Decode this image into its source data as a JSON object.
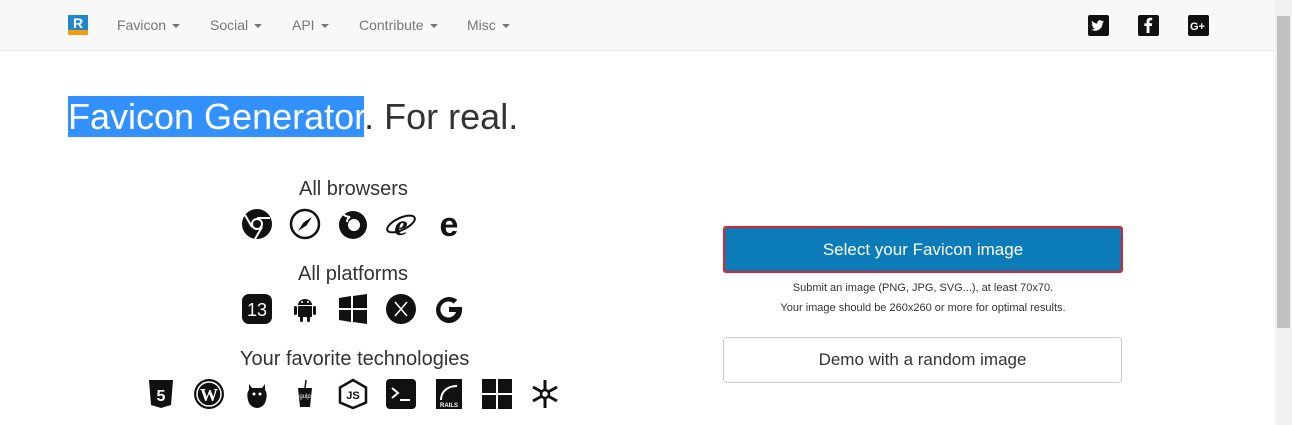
{
  "nav": {
    "items": [
      {
        "label": "Favicon"
      },
      {
        "label": "Social"
      },
      {
        "label": "API"
      },
      {
        "label": "Contribute"
      },
      {
        "label": "Misc"
      }
    ],
    "social": [
      "twitter-icon",
      "facebook-icon",
      "google-plus-icon"
    ]
  },
  "headline": {
    "highlighted": "Favicon Generator",
    "rest": ". For real."
  },
  "groups": [
    {
      "title": "All browsers",
      "icons": [
        "chrome-icon",
        "safari-icon",
        "firefox-icon",
        "internet-explorer-icon",
        "edge-icon"
      ]
    },
    {
      "title": "All platforms",
      "icons": [
        "ios-13-icon",
        "android-icon",
        "windows-icon",
        "macos-x-icon",
        "google-icon"
      ]
    },
    {
      "title": "Your favorite technologies",
      "icons": [
        "html5-icon",
        "wordpress-icon",
        "grunt-icon",
        "gulp-icon",
        "nodejs-icon",
        "cli-icon",
        "rails-icon",
        "aspnet-icon",
        "asterisk-icon"
      ]
    }
  ],
  "main": {
    "select_label": "Select your Favicon image",
    "hint1": "Submit an image (PNG, JPG, SVG...), at least 70x70.",
    "hint2": "Your image should be 260x260 or more for optimal results.",
    "demo_label": "Demo with a random image"
  },
  "colors": {
    "primary": "#0b7cb7",
    "highlight": "#3390ff",
    "focus_border": "#e0202a"
  }
}
